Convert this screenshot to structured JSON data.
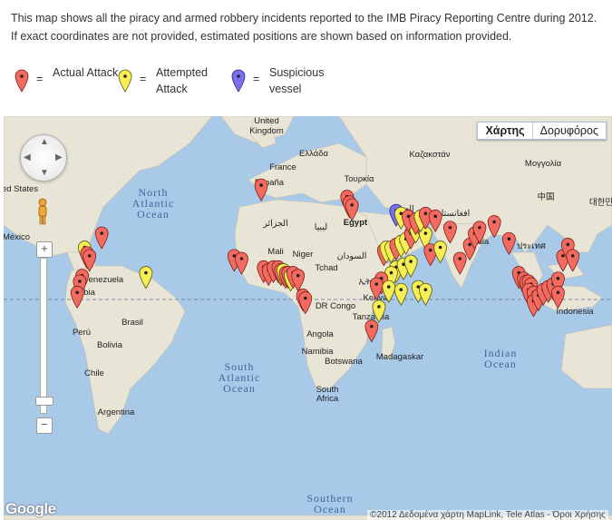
{
  "intro_text": "This map shows all the piracy and armed robbery incidents reported to the IMB Piracy Reporting Centre during 2012. If exact coordinates are not provided, estimated positions are shown based on information provided.",
  "legend": [
    {
      "label": "Actual Attack",
      "color": "#f36b60"
    },
    {
      "label": "Attempted Attack",
      "color": "#f5ee55"
    },
    {
      "label": "Suspicious vessel",
      "color": "#7a6ef2"
    }
  ],
  "legend_equals": "=",
  "map_type": {
    "map_label": "Χάρτης",
    "satellite_label": "Δορυφόρος",
    "active": "map"
  },
  "zoom": {
    "in_label": "+",
    "out_label": "−",
    "out2_label": "−"
  },
  "labels": {
    "united": "United",
    "kingdom": "Kingdom",
    "france": "France",
    "espana": "España",
    "greek1": "Ελλάδα",
    "greek2": "Τουρκία",
    "kazakh": "Καζακστάν",
    "mongolia": "Μογγολία",
    "egypt": "Egypt",
    "iraq": "العراق",
    "afgh": "افغانستان",
    "china": "中国",
    "korea": "대한민",
    "states": "ed States",
    "mexico": "México",
    "venezuela": "Venezuela",
    "colombia": "ombia",
    "brasil": "Brasil",
    "peru": "Perú",
    "bolivia": "Bolivia",
    "chile": "Chile",
    "argentina": "Argentina",
    "algeria": "الجزائر",
    "libya": "ليبيا",
    "mali": "Mali",
    "niger": "Niger",
    "tchad": "Tchad",
    "sudan": "السودان",
    "ethiopia": "ኢትዮጵያ",
    "kenya": "Kenya",
    "tanzania": "Tanza nia",
    "drc": "DR Congo",
    "angola": "Angola",
    "namibia": "Namibia",
    "botswana": "Botswana",
    "south_africa1": "South",
    "south_africa2": "Africa",
    "madagascar": "Madagaskar",
    "india": "India",
    "thai": "ประเทศ",
    "indonesia": "Indonesia",
    "nat_ocean1": "North",
    "nat_ocean2": "Atlantic",
    "nat_ocean3": "Ocean",
    "sat_ocean1": "South",
    "sat_ocean2": "Atlantic",
    "sat_ocean3": "Ocean",
    "ind_ocean1": "Indian",
    "ind_ocean2": "Ocean",
    "southern1": "Southern",
    "southern2": "Ocean"
  },
  "google_logo": "Google",
  "attribution": "©2012 Δεδομένα χάρτη MapLink, Tele Atlas - Όροι Χρήσης",
  "markers": [
    {
      "type": "actual",
      "lon": -70,
      "lat": 18
    },
    {
      "type": "attempted",
      "lon": -77,
      "lat": 13
    },
    {
      "type": "actual",
      "lon": -76,
      "lat": 11
    },
    {
      "type": "actual",
      "lon": -75,
      "lat": 10
    },
    {
      "type": "actual",
      "lon": -78,
      "lat": 3
    },
    {
      "type": "actual",
      "lon": -79,
      "lat": 1
    },
    {
      "type": "actual",
      "lon": -80,
      "lat": -3
    },
    {
      "type": "attempted",
      "lon": -52,
      "lat": 4
    },
    {
      "type": "actual",
      "lon": -5,
      "lat": 35
    },
    {
      "type": "actual",
      "lon": 30,
      "lat": 31
    },
    {
      "type": "actual",
      "lon": 31,
      "lat": 29
    },
    {
      "type": "actual",
      "lon": 32,
      "lat": 28
    },
    {
      "type": "actual",
      "lon": -16,
      "lat": 10
    },
    {
      "type": "actual",
      "lon": -13,
      "lat": 9
    },
    {
      "type": "actual",
      "lon": -4,
      "lat": 6
    },
    {
      "type": "actual",
      "lon": -2,
      "lat": 5
    },
    {
      "type": "actual",
      "lon": 0,
      "lat": 6
    },
    {
      "type": "actual",
      "lon": 2,
      "lat": 6
    },
    {
      "type": "actual",
      "lon": 3,
      "lat": 5
    },
    {
      "type": "attempted",
      "lon": 4,
      "lat": 5
    },
    {
      "type": "actual",
      "lon": 5,
      "lat": 4
    },
    {
      "type": "actual",
      "lon": 6,
      "lat": 4
    },
    {
      "type": "attempted",
      "lon": 7,
      "lat": 3
    },
    {
      "type": "actual",
      "lon": 8,
      "lat": 4
    },
    {
      "type": "actual",
      "lon": 10,
      "lat": 3
    },
    {
      "type": "actual",
      "lon": 12,
      "lat": -4
    },
    {
      "type": "actual",
      "lon": 13,
      "lat": -5
    },
    {
      "type": "actual",
      "lon": 40,
      "lat": -15
    },
    {
      "type": "actual",
      "lon": 45,
      "lat": 12
    },
    {
      "type": "attempted",
      "lon": 46,
      "lat": 13
    },
    {
      "type": "attempted",
      "lon": 48,
      "lat": 13
    },
    {
      "type": "actual",
      "lon": 50,
      "lat": 14
    },
    {
      "type": "attempted",
      "lon": 52,
      "lat": 15
    },
    {
      "type": "attempted",
      "lon": 54,
      "lat": 16
    },
    {
      "type": "actual",
      "lon": 56,
      "lat": 18
    },
    {
      "type": "attempted",
      "lon": 58,
      "lat": 20
    },
    {
      "type": "actual",
      "lon": 60,
      "lat": 22
    },
    {
      "type": "attempted",
      "lon": 62,
      "lat": 18
    },
    {
      "type": "actual",
      "lon": 64,
      "lat": 12
    },
    {
      "type": "attempted",
      "lon": 68,
      "lat": 13
    },
    {
      "type": "attempted",
      "lon": 50,
      "lat": 6
    },
    {
      "type": "attempted",
      "lon": 48,
      "lat": 4
    },
    {
      "type": "attempted",
      "lon": 53,
      "lat": 7
    },
    {
      "type": "attempted",
      "lon": 56,
      "lat": 8
    },
    {
      "type": "actual",
      "lon": 44,
      "lat": 2
    },
    {
      "type": "actual",
      "lon": 42,
      "lat": 0
    },
    {
      "type": "attempted",
      "lon": 47,
      "lat": -1
    },
    {
      "type": "attempted",
      "lon": 52,
      "lat": -2
    },
    {
      "type": "attempted",
      "lon": 59,
      "lat": -1
    },
    {
      "type": "attempted",
      "lon": 62,
      "lat": -2
    },
    {
      "type": "attempted",
      "lon": 43,
      "lat": -8
    },
    {
      "type": "suspicious",
      "lon": 50,
      "lat": 26
    },
    {
      "type": "attempted",
      "lon": 52,
      "lat": 25
    },
    {
      "type": "actual",
      "lon": 55,
      "lat": 24
    },
    {
      "type": "actual",
      "lon": 58,
      "lat": 23
    },
    {
      "type": "attempted",
      "lon": 60,
      "lat": 24
    },
    {
      "type": "actual",
      "lon": 62,
      "lat": 25
    },
    {
      "type": "actual",
      "lon": 66,
      "lat": 24
    },
    {
      "type": "actual",
      "lon": 72,
      "lat": 20
    },
    {
      "type": "actual",
      "lon": 76,
      "lat": 9
    },
    {
      "type": "actual",
      "lon": 80,
      "lat": 14
    },
    {
      "type": "actual",
      "lon": 82,
      "lat": 18
    },
    {
      "type": "actual",
      "lon": 84,
      "lat": 20
    },
    {
      "type": "actual",
      "lon": 90,
      "lat": 22
    },
    {
      "type": "actual",
      "lon": 96,
      "lat": 16
    },
    {
      "type": "actual",
      "lon": 100,
      "lat": 4
    },
    {
      "type": "actual",
      "lon": 102,
      "lat": 2
    },
    {
      "type": "actual",
      "lon": 103,
      "lat": 1
    },
    {
      "type": "actual",
      "lon": 104,
      "lat": 1
    },
    {
      "type": "actual",
      "lon": 105,
      "lat": 0
    },
    {
      "type": "actual",
      "lon": 104,
      "lat": -2
    },
    {
      "type": "actual",
      "lon": 106,
      "lat": -3
    },
    {
      "type": "actual",
      "lon": 106,
      "lat": -6
    },
    {
      "type": "actual",
      "lon": 108,
      "lat": -4
    },
    {
      "type": "actual",
      "lon": 110,
      "lat": -2
    },
    {
      "type": "actual",
      "lon": 112,
      "lat": -1
    },
    {
      "type": "actual",
      "lon": 114,
      "lat": 0
    },
    {
      "type": "actual",
      "lon": 116,
      "lat": 2
    },
    {
      "type": "actual",
      "lon": 118,
      "lat": 10
    },
    {
      "type": "actual",
      "lon": 120,
      "lat": 14
    },
    {
      "type": "actual",
      "lon": 122,
      "lat": 10
    },
    {
      "type": "actual",
      "lon": 116,
      "lat": -3
    }
  ]
}
